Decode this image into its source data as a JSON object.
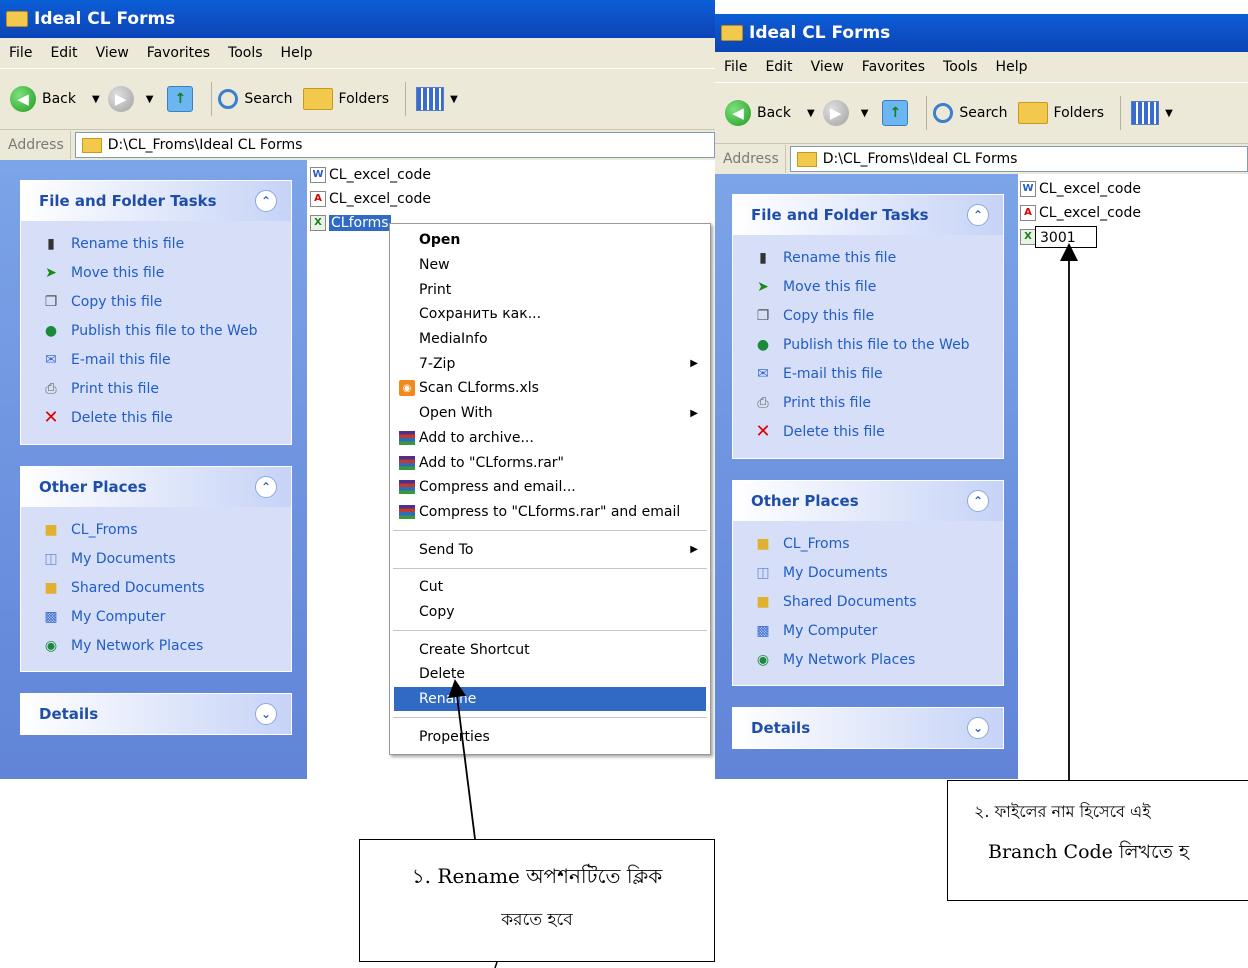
{
  "window_title": "Ideal CL Forms",
  "menu": [
    "File",
    "Edit",
    "View",
    "Favorites",
    "Tools",
    "Help"
  ],
  "toolbar": {
    "back": "Back",
    "search": "Search",
    "folders": "Folders"
  },
  "address": {
    "label": "Address",
    "path": "D:\\CL_Froms\\Ideal CL Forms"
  },
  "tasks_panel": {
    "title": "File and Folder Tasks",
    "items": [
      "Rename this file",
      "Move this file",
      "Copy this file",
      "Publish this file to the Web",
      "E-mail this file",
      "Print this file",
      "Delete this file"
    ]
  },
  "places_panel": {
    "title": "Other Places",
    "items": [
      "CL_Froms",
      "My Documents",
      "Shared Documents",
      "My Computer",
      "My Network Places"
    ]
  },
  "details_panel": {
    "title": "Details"
  },
  "files": [
    "CL_excel_code",
    "CL_excel_code",
    "CLforms"
  ],
  "rename_value": "3001",
  "context_menu": [
    "Open",
    "New",
    "Print",
    "Сохранить как...",
    "MediaInfo",
    "7-Zip",
    "Scan CLforms.xls",
    "Open With",
    "Add to archive...",
    "Add to \"CLforms.rar\"",
    "Compress and email...",
    "Compress to \"CLforms.rar\" and email",
    "Send To",
    "Cut",
    "Copy",
    "Create Shortcut",
    "Delete",
    "Rename",
    "Properties"
  ],
  "callout1": {
    "line1": "১. Rename অপশনটিতে ক্লিক",
    "line2": "করতে হবে"
  },
  "callout2": {
    "line1": "২. ফাইলের নাম হিসেবে এই",
    "line2": "Branch Code লিখতে হ"
  },
  "colors": {
    "title_blue": "#0e52c8",
    "task_link": "#215dc6",
    "panel_bg": "#d6dff7",
    "selection": "#316ac5"
  }
}
